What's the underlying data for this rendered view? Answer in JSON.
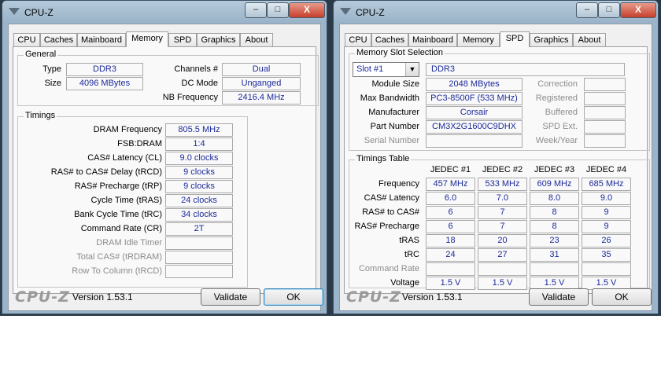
{
  "colors": {
    "value_text": "#1c2a9a",
    "window_frame": "#9cb4c9",
    "desktop": "#2a3a48"
  },
  "left_window": {
    "title": "CPU-Z",
    "title_buttons": {
      "minimize": "–",
      "maximize": "□",
      "close": "X"
    },
    "tabs": [
      {
        "label": "CPU"
      },
      {
        "label": "Caches"
      },
      {
        "label": "Mainboard"
      },
      {
        "label": "Memory"
      },
      {
        "label": "SPD"
      },
      {
        "label": "Graphics"
      },
      {
        "label": "About"
      }
    ],
    "active_tab": "Memory",
    "general": {
      "title": "General",
      "type_label": "Type",
      "type_value": "DDR3",
      "size_label": "Size",
      "size_value": "4096 MBytes",
      "channels_label": "Channels #",
      "channels_value": "Dual",
      "dc_mode_label": "DC Mode",
      "dc_mode_value": "Unganged",
      "nb_freq_label": "NB Frequency",
      "nb_freq_value": "2416.4 MHz"
    },
    "timings": {
      "title": "Timings",
      "rows": [
        {
          "label": "DRAM Frequency",
          "value": "805.5 MHz"
        },
        {
          "label": "FSB:DRAM",
          "value": "1:4"
        },
        {
          "label": "CAS# Latency (CL)",
          "value": "9.0 clocks"
        },
        {
          "label": "RAS# to CAS# Delay (tRCD)",
          "value": "9 clocks"
        },
        {
          "label": "RAS# Precharge (tRP)",
          "value": "9 clocks"
        },
        {
          "label": "Cycle Time (tRAS)",
          "value": "24 clocks"
        },
        {
          "label": "Bank Cycle Time (tRC)",
          "value": "34 clocks"
        },
        {
          "label": "Command Rate (CR)",
          "value": "2T"
        },
        {
          "label": "DRAM Idle Timer",
          "value": ""
        },
        {
          "label": "Total CAS# (tRDRAM)",
          "value": ""
        },
        {
          "label": "Row To Column (tRCD)",
          "value": ""
        }
      ]
    },
    "footer": {
      "logo": "CPU-Z",
      "version": "Version 1.53.1",
      "validate": "Validate",
      "ok": "OK"
    }
  },
  "right_window": {
    "title": "CPU-Z",
    "title_buttons": {
      "minimize": "–",
      "maximize": "□",
      "close": "X"
    },
    "tabs": [
      {
        "label": "CPU"
      },
      {
        "label": "Caches"
      },
      {
        "label": "Mainboard"
      },
      {
        "label": "Memory"
      },
      {
        "label": "SPD"
      },
      {
        "label": "Graphics"
      },
      {
        "label": "About"
      }
    ],
    "active_tab": "SPD",
    "slot": {
      "title": "Memory Slot Selection",
      "selected_slot": "Slot #1",
      "type_value": "DDR3",
      "module_size_label": "Module Size",
      "module_size_value": "2048 MBytes",
      "max_bw_label": "Max Bandwidth",
      "max_bw_value": "PC3-8500F (533 MHz)",
      "manufacturer_label": "Manufacturer",
      "manufacturer_value": "Corsair",
      "part_label": "Part Number",
      "part_value": "CM3X2G1600C9DHX",
      "serial_label": "Serial Number",
      "serial_value": "",
      "correction_label": "Correction",
      "correction_value": "",
      "registered_label": "Registered",
      "registered_value": "",
      "buffered_label": "Buffered",
      "buffered_value": "",
      "spd_ext_label": "SPD Ext.",
      "spd_ext_value": "",
      "week_year_label": "Week/Year",
      "week_year_value": ""
    },
    "timings_table": {
      "title": "Timings Table",
      "columns": [
        "JEDEC #1",
        "JEDEC #2",
        "JEDEC #3",
        "JEDEC #4"
      ],
      "rows": [
        {
          "label": "Frequency",
          "values": [
            "457 MHz",
            "533 MHz",
            "609 MHz",
            "685 MHz"
          ]
        },
        {
          "label": "CAS# Latency",
          "values": [
            "6.0",
            "7.0",
            "8.0",
            "9.0"
          ]
        },
        {
          "label": "RAS# to CAS#",
          "values": [
            "6",
            "7",
            "8",
            "9"
          ]
        },
        {
          "label": "RAS# Precharge",
          "values": [
            "6",
            "7",
            "8",
            "9"
          ]
        },
        {
          "label": "tRAS",
          "values": [
            "18",
            "20",
            "23",
            "26"
          ]
        },
        {
          "label": "tRC",
          "values": [
            "24",
            "27",
            "31",
            "35"
          ]
        },
        {
          "label": "Command Rate",
          "values": [
            "",
            "",
            "",
            ""
          ]
        },
        {
          "label": "Voltage",
          "values": [
            "1.5 V",
            "1.5 V",
            "1.5 V",
            "1.5 V"
          ]
        }
      ]
    },
    "footer": {
      "logo": "CPU-Z",
      "version": "Version 1.53.1",
      "validate": "Validate",
      "ok": "OK"
    }
  }
}
